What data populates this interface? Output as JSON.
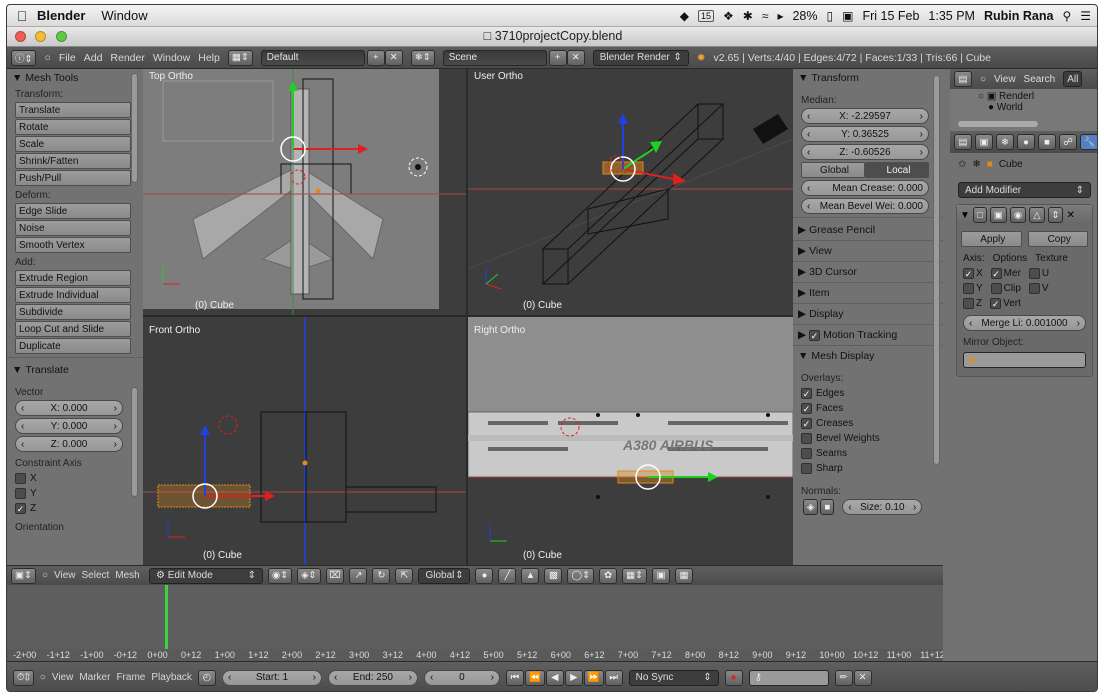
{
  "menubar": {
    "app": "Blender",
    "menu": "Window",
    "battery": "28%",
    "date": "Fri 15 Feb",
    "time": "1:35 PM",
    "user": "Rubin Rana",
    "calendar_day": "15"
  },
  "window": {
    "title": "3710projectCopy.blend"
  },
  "header": {
    "menus": [
      "File",
      "Add",
      "Render",
      "Window",
      "Help"
    ],
    "layout": "Default",
    "scene": "Scene",
    "engine": "Blender Render",
    "stats": "v2.65 | Verts:4/40 | Edges:4/72 | Faces:1/33 | Tris:66 | Cube"
  },
  "tools": {
    "title": "Mesh Tools",
    "transform_label": "Transform:",
    "transform": [
      "Translate",
      "Rotate",
      "Scale",
      "Shrink/Fatten",
      "Push/Pull"
    ],
    "deform_label": "Deform:",
    "deform": [
      "Edge Slide",
      "Noise",
      "Smooth Vertex"
    ],
    "add_label": "Add:",
    "add": [
      "Extrude Region",
      "Extrude Individual",
      "Subdivide",
      "Loop Cut and Slide",
      "Duplicate"
    ]
  },
  "operator": {
    "title": "Translate",
    "vector_label": "Vector",
    "x": "X: 0.000",
    "y": "Y: 0.000",
    "z": "Z: 0.000",
    "constraint_label": "Constraint Axis",
    "axes": [
      {
        "label": "X",
        "checked": false
      },
      {
        "label": "Y",
        "checked": false
      },
      {
        "label": "Z",
        "checked": true
      }
    ],
    "orientation_label": "Orientation"
  },
  "viewports": [
    {
      "name": "Top Ortho",
      "object": "(0) Cube"
    },
    {
      "name": "User Ortho",
      "object": "(0) Cube"
    },
    {
      "name": "Front Ortho",
      "object": "(0) Cube"
    },
    {
      "name": "Right Ortho",
      "object": "(0) Cube"
    }
  ],
  "airbus_text": "A380 AIRBUS",
  "properties_panel": {
    "transform_title": "Transform",
    "median_label": "Median:",
    "x": "X: -2.29597",
    "y": "Y: 0.36525",
    "z": "Z: -0.60526",
    "global": "Global",
    "local": "Local",
    "crease": "Mean Crease: 0.000",
    "bevel": "Mean Bevel Wei: 0.000",
    "sections": [
      "Grease Pencil",
      "View",
      "3D Cursor",
      "Item",
      "Display",
      "Motion Tracking"
    ],
    "mesh_display_title": "Mesh Display",
    "overlays_label": "Overlays:",
    "overlays": [
      {
        "label": "Edges",
        "checked": true
      },
      {
        "label": "Faces",
        "checked": true
      },
      {
        "label": "Creases",
        "checked": true
      },
      {
        "label": "Bevel Weights",
        "checked": false
      },
      {
        "label": "Seams",
        "checked": false
      },
      {
        "label": "Sharp",
        "checked": false
      }
    ],
    "normals_label": "Normals:",
    "normals_size": "Size: 0.10"
  },
  "outliner": {
    "view": "View",
    "search": "Search",
    "all": "All",
    "items": [
      "Renderl",
      "World"
    ]
  },
  "modifiers": {
    "object": "Cube",
    "add_modifier": "Add Modifier",
    "apply": "Apply",
    "copy": "Copy",
    "axis_label": "Axis:",
    "options_label": "Options",
    "texture_label": "Texture",
    "x": "X",
    "y": "Y",
    "z": "Z",
    "merge": "Mer",
    "clip": "Clip",
    "vert": "Vert",
    "u": "U",
    "v": "V",
    "merge_limit": "Merge Li: 0.001000",
    "mirror_object_label": "Mirror Object:"
  },
  "vp_header": {
    "menus": [
      "View",
      "Select",
      "Mesh"
    ],
    "mode": "Edit Mode",
    "orientation": "Global"
  },
  "timeline": {
    "menus": [
      "View",
      "Marker",
      "Frame",
      "Playback"
    ],
    "start": "Start: 1",
    "end": "End: 250",
    "current": "0",
    "sync": "No Sync",
    "ruler": [
      "-2+00",
      "-1+12",
      "-1+00",
      "-0+12",
      "0+00",
      "0+12",
      "1+00",
      "1+12",
      "2+00",
      "2+12",
      "3+00",
      "3+12",
      "4+00",
      "4+12",
      "5+00",
      "5+12",
      "6+00",
      "6+12",
      "7+00",
      "7+12",
      "8+00",
      "8+12",
      "9+00",
      "9+12",
      "10+00",
      "10+12",
      "11+00",
      "11+12"
    ]
  },
  "colors": {
    "selection": "#e08a1c",
    "x_axis": "#d02020",
    "y_axis": "#30c030",
    "z_axis": "#2040e0",
    "panel": "#727272",
    "viewport": "#3d3d3d"
  }
}
